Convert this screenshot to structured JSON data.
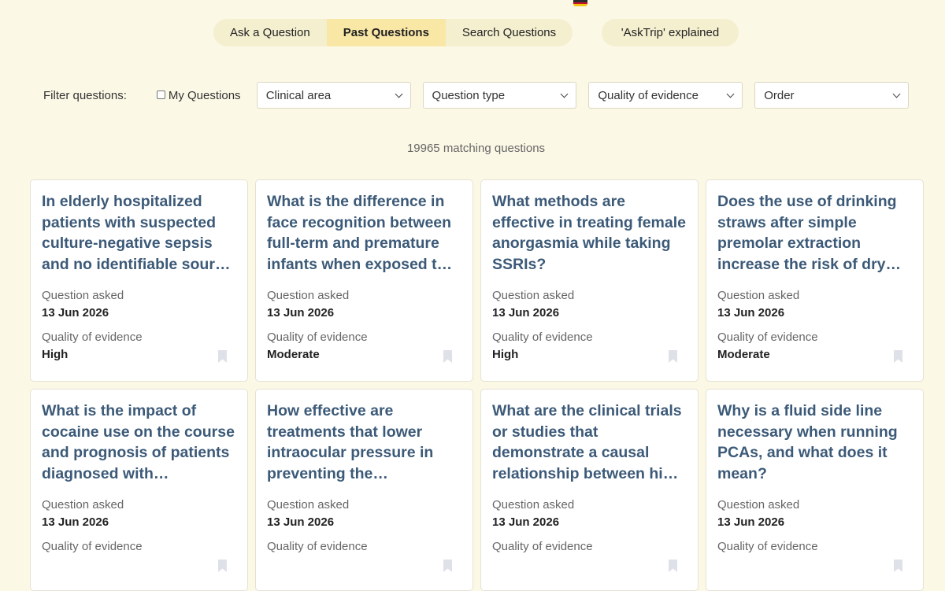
{
  "nav": {
    "tabs": [
      {
        "label": "Ask a Question"
      },
      {
        "label": "Past Questions"
      },
      {
        "label": "Search Questions"
      }
    ],
    "active_tab": "Past Questions",
    "explain_label": "'AskTrip' explained"
  },
  "filters": {
    "label": "Filter questions:",
    "my_questions": "My Questions",
    "clinical_area": "Clinical area",
    "question_type": "Question type",
    "quality": "Quality of evidence",
    "order": "Order"
  },
  "result_count": "19965 matching questions",
  "cards": [
    {
      "question": "In elderly hospitalized patients with suspected culture-negative sepsis and no identifiable source of infection",
      "asked_label": "Question asked",
      "date": "13 Jun 2026",
      "quality_label": "Quality of evidence",
      "quality": "High"
    },
    {
      "question": "What is the difference in face recognition between full-term and premature infants when exposed to faces",
      "asked_label": "Question asked",
      "date": "13 Jun 2026",
      "quality_label": "Quality of evidence",
      "quality": "Moderate"
    },
    {
      "question": "What methods are effective in treating female anorgasmia while taking SSRIs?",
      "asked_label": "Question asked",
      "date": "13 Jun 2026",
      "quality_label": "Quality of evidence",
      "quality": "High"
    },
    {
      "question": "Does the use of drinking straws after simple premolar extraction increase the risk of dry socket",
      "asked_label": "Question asked",
      "date": "13 Jun 2026",
      "quality_label": "Quality of evidence",
      "quality": "Moderate"
    },
    {
      "question": "What is the impact of cocaine use on the course and prognosis of patients diagnosed with schizophrenia",
      "asked_label": "Question asked",
      "date": "13 Jun 2026",
      "quality_label": "Quality of evidence",
      "quality": ""
    },
    {
      "question": "How effective are treatments that lower intraocular pressure in preventing the progression of glaucoma",
      "asked_label": "Question asked",
      "date": "13 Jun 2026",
      "quality_label": "Quality of evidence",
      "quality": ""
    },
    {
      "question": "What are the clinical trials or studies that demonstrate a causal relationship between high blood pressure",
      "asked_label": "Question asked",
      "date": "13 Jun 2026",
      "quality_label": "Quality of evidence",
      "quality": ""
    },
    {
      "question": "Why is a fluid side line necessary when running PCAs, and what does it mean?",
      "asked_label": "Question asked",
      "date": "13 Jun 2026",
      "quality_label": "Quality of evidence",
      "quality": ""
    }
  ]
}
